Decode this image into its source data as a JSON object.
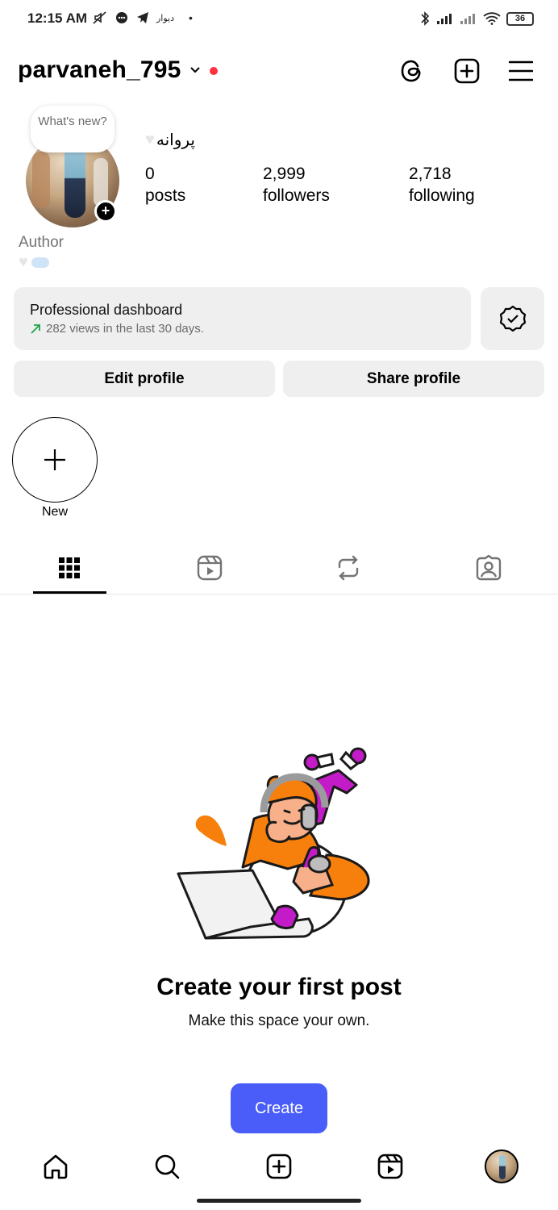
{
  "status_bar": {
    "time": "12:15 AM",
    "app_label": "دیوار",
    "battery": "36",
    "icons": [
      "mute-icon",
      "chat-icon",
      "telegram-icon",
      "bluetooth-icon",
      "signal-icon",
      "signal-icon",
      "wifi-icon",
      "battery-icon"
    ]
  },
  "header": {
    "username": "parvaneh_795",
    "icons": [
      "threads-icon",
      "create-icon",
      "menu-icon"
    ],
    "notification_dot_color": "#ff3040"
  },
  "profile": {
    "note_bubble": "What's new?",
    "display_name": "پروانه",
    "stats": [
      {
        "value": "0",
        "label": "posts"
      },
      {
        "value": "2,999",
        "label": "followers"
      },
      {
        "value": "2,718",
        "label": "following"
      }
    ],
    "category": "Author"
  },
  "dashboard": {
    "title": "Professional dashboard",
    "subtitle": "282 views in the last 30 days.",
    "trend_color": "#1fa34a"
  },
  "buttons": {
    "edit_profile": "Edit profile",
    "share_profile": "Share profile"
  },
  "highlights": {
    "new_label": "New"
  },
  "tabs": [
    "grid-icon",
    "reels-icon",
    "reposts-icon",
    "tagged-icon"
  ],
  "empty_state": {
    "title": "Create your first post",
    "subtitle": "Make this space your own.",
    "button": "Create"
  },
  "bottom_nav": [
    "home-icon",
    "search-icon",
    "create-icon",
    "reels-icon",
    "profile-avatar"
  ],
  "colors": {
    "accent": "#4a5df9",
    "surface": "#efefef",
    "illustration_orange": "#f77f0b",
    "illustration_magenta": "#c41bc8"
  }
}
